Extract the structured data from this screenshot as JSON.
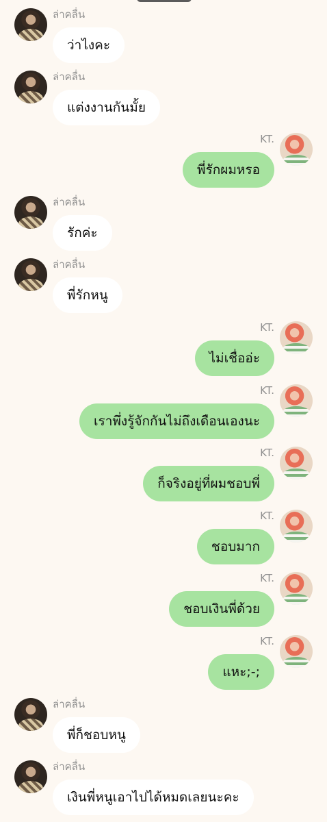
{
  "contacts": {
    "left_name": "ล่าคลื่น",
    "right_name": "KT."
  },
  "messages": [
    {
      "side": "left",
      "text": "ว่าไงคะ"
    },
    {
      "side": "left",
      "text": "แต่งงานกันมั้ย"
    },
    {
      "side": "right",
      "text": "พี่รักผมหรอ"
    },
    {
      "side": "left",
      "text": "รักค่ะ"
    },
    {
      "side": "left",
      "text": "พี่รักหนู"
    },
    {
      "side": "right",
      "text": "ไม่เชื่ออ่ะ"
    },
    {
      "side": "right",
      "text": "เราพึ่งรู้จักกันไม่ถึงเดือนเองนะ"
    },
    {
      "side": "right",
      "text": "ก็จริงอยู่ที่ผมชอบพี่"
    },
    {
      "side": "right",
      "text": "ชอบมาก"
    },
    {
      "side": "right",
      "text": "ชอบเงินพี่ด้วย"
    },
    {
      "side": "right",
      "text": "แหะ;-;"
    },
    {
      "side": "left",
      "text": "พี่ก็ชอบหนู"
    },
    {
      "side": "left",
      "text": "เงินพี่หนูเอาไปได้หมดเลยนะคะ"
    }
  ],
  "colors": {
    "background": "#fdf8f2",
    "incoming_bubble": "#ffffff",
    "outgoing_bubble": "#a7e3a0",
    "name_text": "#8f8f8f"
  },
  "icons": {
    "left_avatar": "profile-photo",
    "right_avatar": "profile-photo"
  }
}
